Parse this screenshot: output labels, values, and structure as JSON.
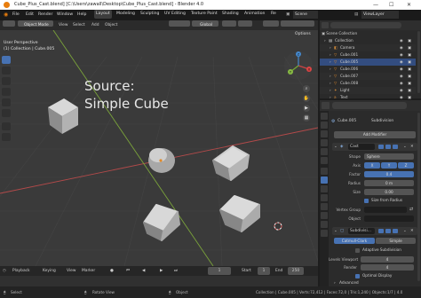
{
  "window": {
    "title": "Cube_Plus_Cast.blend] [C:\\Users\\zawall\\Desktop\\Cube_Plus_Cast.blend] - Blender 4.0",
    "controls": [
      "—",
      "☐",
      "✕"
    ]
  },
  "menu": {
    "items": [
      "File",
      "Edit",
      "Render",
      "Window",
      "Help"
    ],
    "workspaces": [
      "Layout",
      "Modeling",
      "Sculpting",
      "UV Editing",
      "Texture Paint",
      "Shading",
      "Animation",
      "Re"
    ],
    "active_workspace": "Layout",
    "scene_label": "Scene",
    "viewlayer_label": "ViewLayer"
  },
  "viewport": {
    "mode": "Object Mode",
    "menus": [
      "View",
      "Select",
      "Add",
      "Object"
    ],
    "orientation": "Global",
    "options_label": "Options",
    "view_name": "User Perspective",
    "collection_info": "(1) Collection | Cube.005",
    "overlay_title_line1": "Source:",
    "overlay_title_line2": "Simple Cube",
    "gizmo_axes": {
      "x": "X",
      "y": "Y",
      "z": "Z"
    }
  },
  "timeline": {
    "menus": [
      "Playback",
      "Keying",
      "View",
      "Marker"
    ],
    "current_frame": "1",
    "start_label": "Start",
    "start_value": "1",
    "end_label": "End",
    "end_value": "250"
  },
  "status": {
    "select": "Select",
    "rotate": "Rotate View",
    "object": "Object",
    "stats": "Collection | Cube.005 | Verts:72,412 | Faces:72,0 | Tris:1,240 | Objects:1/7 | 4.0"
  },
  "outliner": {
    "header": "Scene Collection",
    "rows": [
      {
        "name": "Collection",
        "level": 1,
        "icon": "collection-icon"
      },
      {
        "name": "Camera",
        "level": 2,
        "icon": "camera-icon"
      },
      {
        "name": "Cube.001",
        "level": 2,
        "icon": "mesh-icon"
      },
      {
        "name": "Cube.005",
        "level": 2,
        "icon": "mesh-icon"
      },
      {
        "name": "Cube.006",
        "level": 2,
        "icon": "mesh-icon"
      },
      {
        "name": "Cube.007",
        "level": 2,
        "icon": "mesh-icon"
      },
      {
        "name": "Cube.008",
        "level": 2,
        "icon": "mesh-icon"
      },
      {
        "name": "Light",
        "level": 2,
        "icon": "light-icon"
      },
      {
        "name": "Text",
        "level": 2,
        "icon": "text-icon"
      }
    ],
    "selected": "Cube.005"
  },
  "properties": {
    "object_name": "Cube.005",
    "modifier_context": "Subdivision",
    "add_modifier": "Add Modifier",
    "cast": {
      "name": "Cast",
      "shape_label": "Shape",
      "shape_value": "Sphere",
      "axis_label": "Axis",
      "axis_values": [
        "X",
        "Y",
        "Z"
      ],
      "factor_label": "Factor",
      "factor_value": "0.4",
      "radius_label": "Radius",
      "radius_value": "0 m",
      "size_label": "Size",
      "size_value": "0.00",
      "size_from_radius": "Size from Radius",
      "vertex_group_label": "Vertex Group",
      "object_label": "Object"
    },
    "subdivision": {
      "name": "Subdivisi...",
      "catmull": "Catmull-Clark",
      "simple": "Simple",
      "adaptive": "Adaptive Subdivision",
      "levels_viewport_label": "Levels Viewport",
      "levels_viewport_value": "4",
      "render_label": "Render",
      "render_value": "4",
      "optimal_display": "Optimal Display",
      "advanced": "Advanced"
    }
  },
  "colors": {
    "accent": "#4772b3",
    "viewport_bg": "#3a3a3a",
    "grid_line": "#454545",
    "x_axis": "#b34a4a",
    "y_axis": "#7aa33a",
    "selected_outline": "#e08a2a",
    "modifier_orange": "#4772b3"
  }
}
